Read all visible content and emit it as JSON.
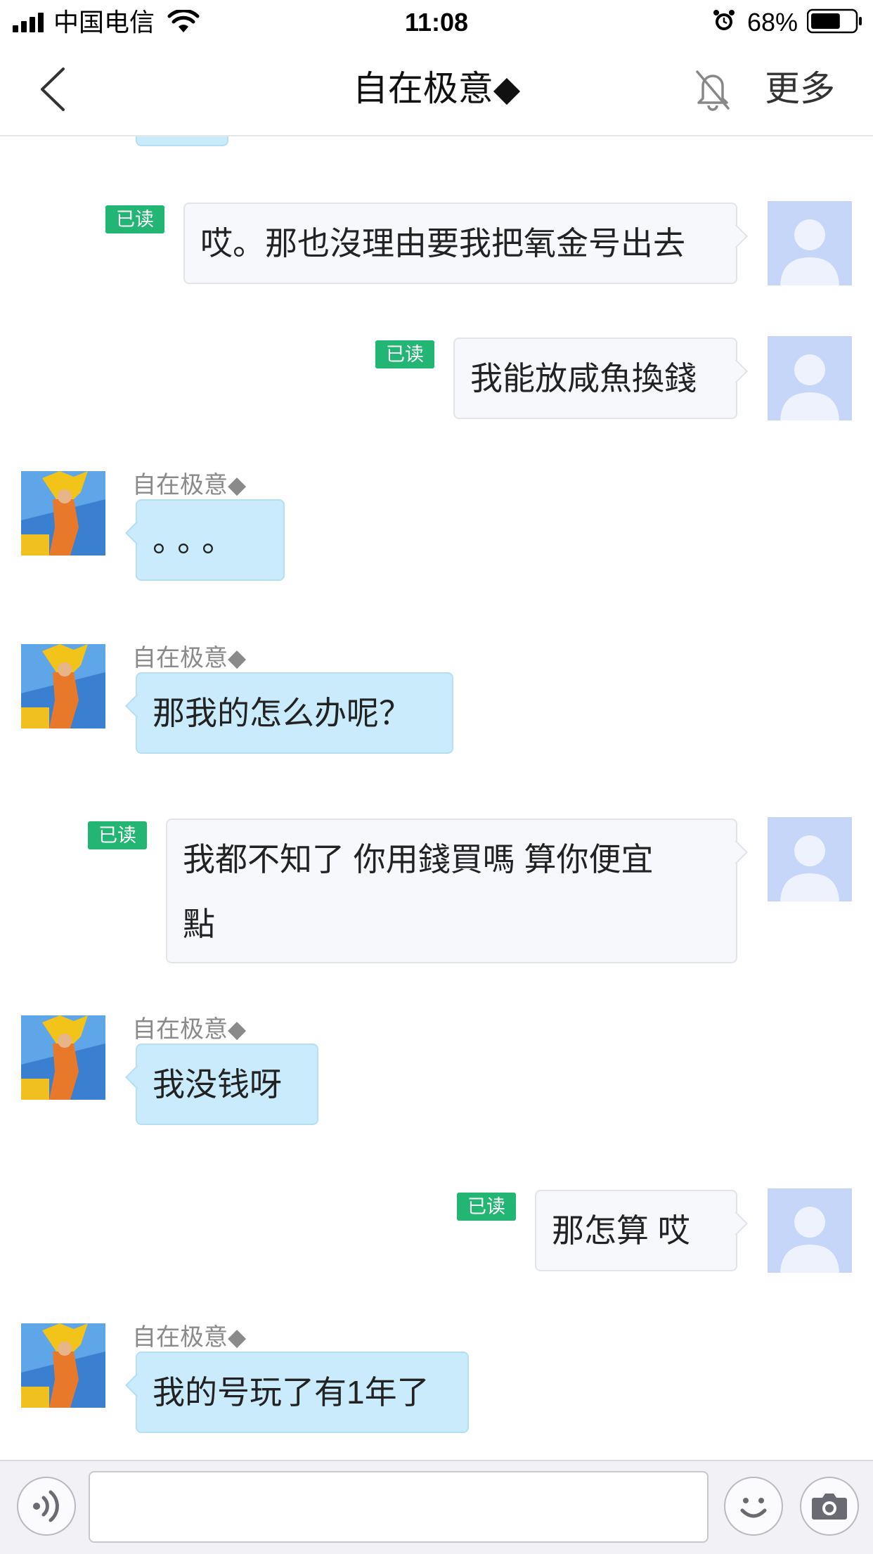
{
  "status_bar": {
    "carrier": "中国电信",
    "time": "11:08",
    "battery_percent": "68%",
    "battery_level": 0.68,
    "icons": [
      "signal-icon",
      "wifi-icon",
      "alarm-icon",
      "battery-icon"
    ]
  },
  "nav": {
    "title": "自在极意◆",
    "more_label": "更多",
    "icons": [
      "back-arrow-icon",
      "mute-bell-icon"
    ]
  },
  "chat": {
    "contact_name": "自在极意◆",
    "read_label": "已读",
    "messages": [
      {
        "from": "me",
        "text": "哎。那也沒理由要我把氧金号出去",
        "read": true
      },
      {
        "from": "me",
        "text": "我能放咸魚換錢",
        "read": true
      },
      {
        "from": "other",
        "sender": "自在极意◆",
        "text": "。。。"
      },
      {
        "from": "other",
        "sender": "自在极意◆",
        "text": "那我的怎么办呢？"
      },
      {
        "from": "me",
        "text": "我都不知了 你用錢買嗎 算你便宜\n點",
        "read": true
      },
      {
        "from": "other",
        "sender": "自在极意◆",
        "text": "我没钱呀"
      },
      {
        "from": "me",
        "text": "那怎算 哎",
        "read": true
      },
      {
        "from": "other",
        "sender": "自在极意◆",
        "text": "我的号玩了有1年了"
      }
    ]
  },
  "input_bar": {
    "placeholder": "",
    "icons": [
      "voice-icon",
      "emoji-icon",
      "camera-icon"
    ]
  },
  "colors": {
    "read_badge": "#22b573",
    "incoming_bubble": "#c9ebfb",
    "outgoing_bubble": "#f7f8fc",
    "my_avatar_bg": "#c6d6f8"
  }
}
